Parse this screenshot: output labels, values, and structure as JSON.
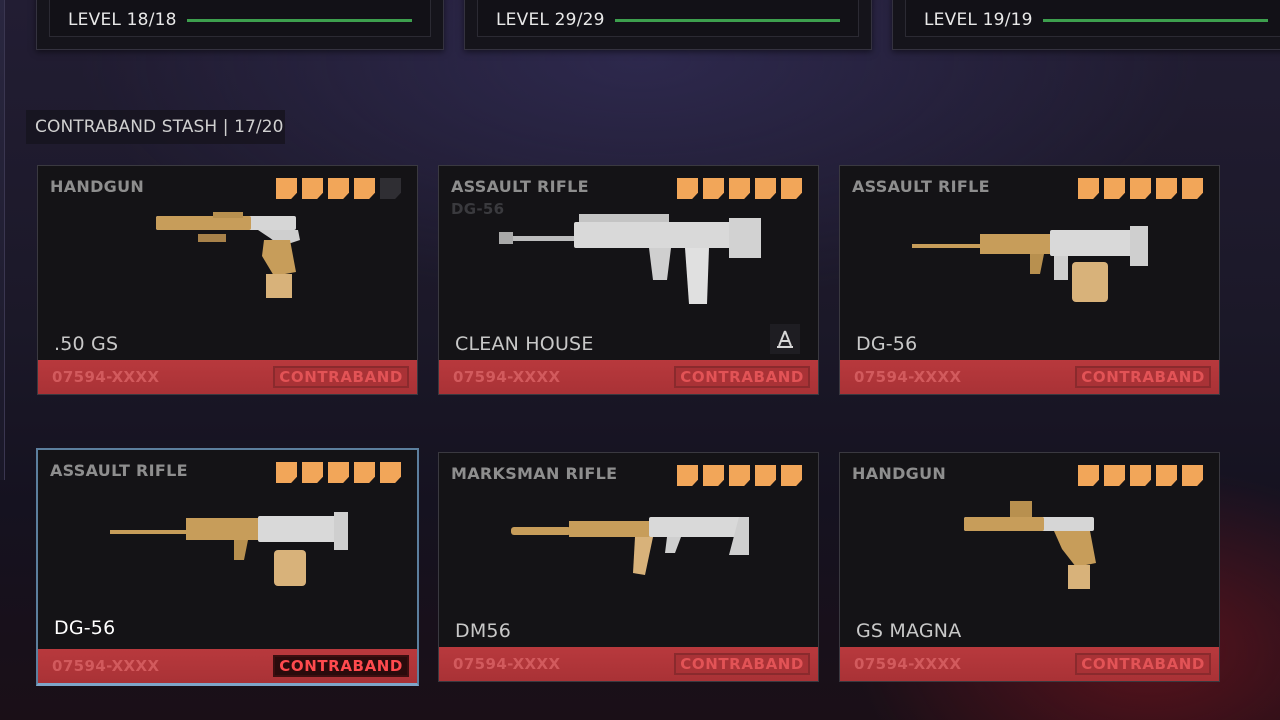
{
  "levels": [
    {
      "label": "LEVEL 18/18"
    },
    {
      "label": "LEVEL 29/29"
    },
    {
      "label": "LEVEL 19/19"
    }
  ],
  "stash": {
    "label": "CONTRABAND STASH | 17/20"
  },
  "colors": {
    "tier": "#f2a659",
    "tier_empty": "#2f2e33",
    "footer": "#b8393d",
    "level_bar": "#3d9f4e",
    "selected_border": "#7fa6c9"
  },
  "cards": [
    {
      "category": "HANDGUN",
      "subtitle": "",
      "name": ".50 GS",
      "tiers_filled": 4,
      "tiers_total": 5,
      "serial": "07594-XXXX",
      "tag": "CONTRABAND",
      "icon": "pistol-gold-icon"
    },
    {
      "category": "ASSAULT RIFLE",
      "subtitle": "DG-56",
      "name": "CLEAN HOUSE",
      "tiers_filled": 5,
      "tiers_total": 5,
      "serial": "07594-XXXX",
      "tag": "CONTRABAND",
      "icon": "rifle-silver-icon",
      "blueprint_icon": "blueprint-compass-icon"
    },
    {
      "category": "ASSAULT RIFLE",
      "subtitle": "",
      "name": "DG-56",
      "tiers_filled": 5,
      "tiers_total": 5,
      "serial": "07594-XXXX",
      "tag": "CONTRABAND",
      "icon": "rifle-gold-drum-icon"
    },
    {
      "category": "ASSAULT RIFLE",
      "subtitle": "",
      "name": "DG-56",
      "tiers_filled": 5,
      "tiers_total": 5,
      "serial": "07594-XXXX",
      "tag": "CONTRABAND",
      "icon": "rifle-gold-drum-icon",
      "selected": true
    },
    {
      "category": "MARKSMAN RIFLE",
      "subtitle": "",
      "name": "DM56",
      "tiers_filled": 5,
      "tiers_total": 5,
      "serial": "07594-XXXX",
      "tag": "CONTRABAND",
      "icon": "marksman-rifle-icon"
    },
    {
      "category": "HANDGUN",
      "subtitle": "",
      "name": "GS MAGNA",
      "tiers_filled": 5,
      "tiers_total": 5,
      "serial": "07594-XXXX",
      "tag": "CONTRABAND",
      "icon": "pistol-gold-icon"
    }
  ]
}
